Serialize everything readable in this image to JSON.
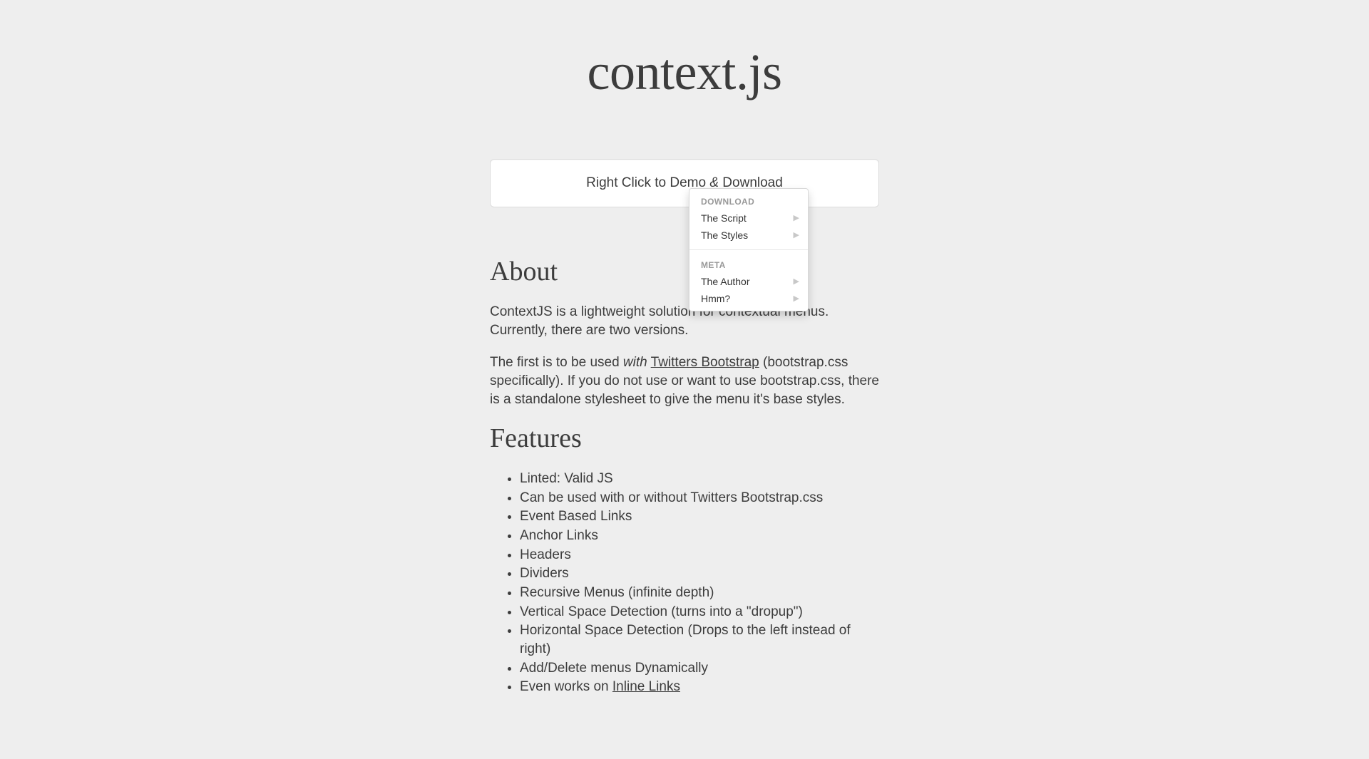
{
  "page_title": "context.js",
  "demo_box": {
    "prefix": "Right Click to Demo ",
    "amp": "&",
    "suffix": " Download"
  },
  "context_menu": {
    "sections": [
      {
        "header": "DOWNLOAD",
        "items": [
          {
            "label": "The Script",
            "has_submenu": true
          },
          {
            "label": "The Styles",
            "has_submenu": true
          }
        ]
      },
      {
        "header": "META",
        "items": [
          {
            "label": "The Author",
            "has_submenu": true
          },
          {
            "label": "Hmm?",
            "has_submenu": true
          }
        ]
      }
    ]
  },
  "about": {
    "heading": "About",
    "p1": "ContextJS is a lightweight solution for contextual menus. Currently, there are two versions.",
    "p2_a": "The first is to be used ",
    "p2_with": "with",
    "p2_space": " ",
    "p2_link": "Twitters Bootstrap",
    "p2_b": " (bootstrap.css specifically). If you do not use or want to use bootstrap.css, there is a standalone stylesheet to give the menu it's base styles."
  },
  "features": {
    "heading": "Features",
    "items": [
      "Linted: Valid JS",
      "Can be used with or without Twitters Bootstrap.css",
      "Event Based Links",
      "Anchor Links",
      "Headers",
      "Dividers",
      "Recursive Menus (infinite depth)",
      "Vertical Space Detection (turns into a \"dropup\")",
      "Horizontal Space Detection (Drops to the left instead of right)",
      "Add/Delete menus Dynamically"
    ],
    "last_prefix": "Even works on ",
    "last_link": "Inline Links"
  }
}
